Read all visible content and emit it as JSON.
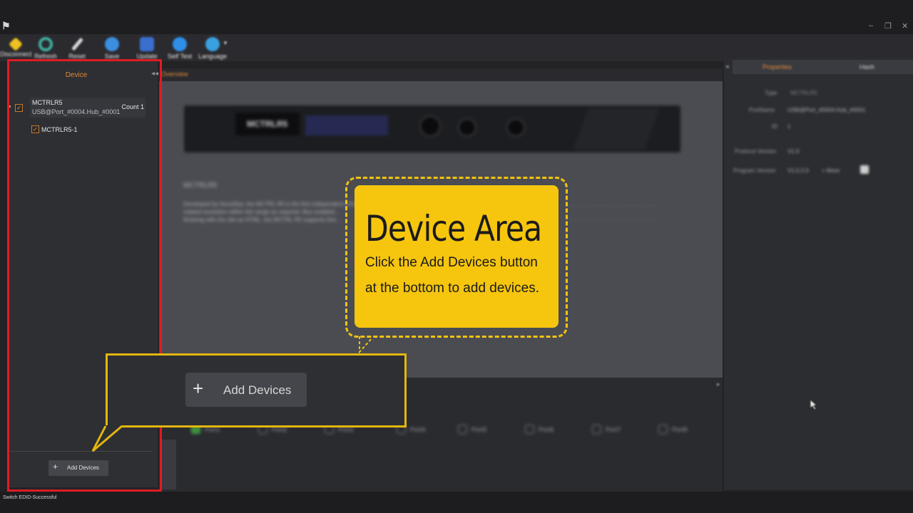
{
  "toolbar": {
    "items": [
      {
        "label": "Disconnect",
        "color": "#f0c020"
      },
      {
        "label": "Refresh",
        "color": "#3fb0a0"
      },
      {
        "label": "Reset",
        "color": "#d8d8d8"
      },
      {
        "label": "Save",
        "color": "#3c8fe0"
      },
      {
        "label": "Update",
        "color": "#3a6fd0"
      },
      {
        "label": "Self Test",
        "color": "#2f8fe8"
      },
      {
        "label": "Language",
        "color": "#3aa0e0"
      }
    ]
  },
  "device_panel": {
    "title": "Device",
    "device": {
      "name": "MCTRLR5",
      "port": "USB@Port_#0004.Hub_#0001",
      "count": "Count 1",
      "checked": true
    },
    "sub_device": {
      "name": "MCTRLR5-1",
      "checked": true
    },
    "add_button_label": "Add Devices"
  },
  "center": {
    "tab_label": "Overview",
    "device_display_text": "MCTRLR5",
    "heading": "MCTRLR5",
    "description_lines": [
      "Developed by NovaStar, the MCTRL R5 is the first independent LED display controller...",
      "rotated resolution within the range as required. Bus enabled...",
      "finishing with the site as HTML, the MCTRL R5 supports fine..."
    ],
    "ports": [
      "Port1",
      "Port2",
      "Port3",
      "Port4",
      "Port5",
      "Port6",
      "Port7",
      "Port8"
    ]
  },
  "properties": {
    "tabs": [
      "Properties",
      "Hash"
    ],
    "rows": [
      {
        "label": "Type",
        "value": "MCTRLR5"
      },
      {
        "label": "PortName",
        "value": "USB@Port_#0004.Hub_#0001"
      },
      {
        "label": "ID",
        "value": "1"
      },
      {
        "label": "Protocol Version",
        "value": "V1.0"
      },
      {
        "label": "Program Version",
        "value": "V1.0.2.0"
      }
    ],
    "more_label": "More"
  },
  "status": {
    "text": "Switch EDID-Successful"
  },
  "callout": {
    "title": "Device Area",
    "line1": "Click the Add Devices button",
    "line2": "at the bottom to add devices."
  },
  "zoom": {
    "button_label": "Add Devices"
  }
}
